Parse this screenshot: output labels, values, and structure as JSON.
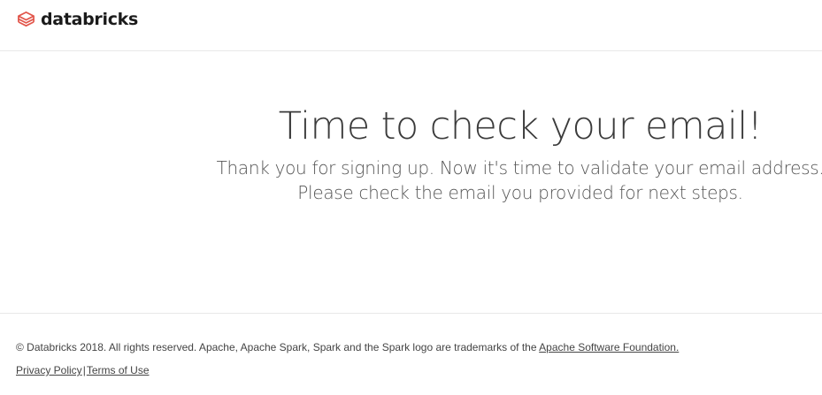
{
  "header": {
    "brand_name": "databricks",
    "logo_icon": "databricks-stack-icon",
    "brand_color": "#e2574c"
  },
  "main": {
    "title": "Time to check your email!",
    "line1": "Thank you for signing up. Now it's time to validate your email address.",
    "line2": "Please check the email you provided for next steps."
  },
  "footer": {
    "copyright_text": "© Databricks 2018. All rights reserved. Apache, Apache Spark, Spark and the Spark logo are trademarks of the ",
    "asf_link": "Apache Software Foundation.",
    "privacy_link": "Privacy Policy",
    "separator": "|",
    "terms_link": "Terms of Use"
  }
}
